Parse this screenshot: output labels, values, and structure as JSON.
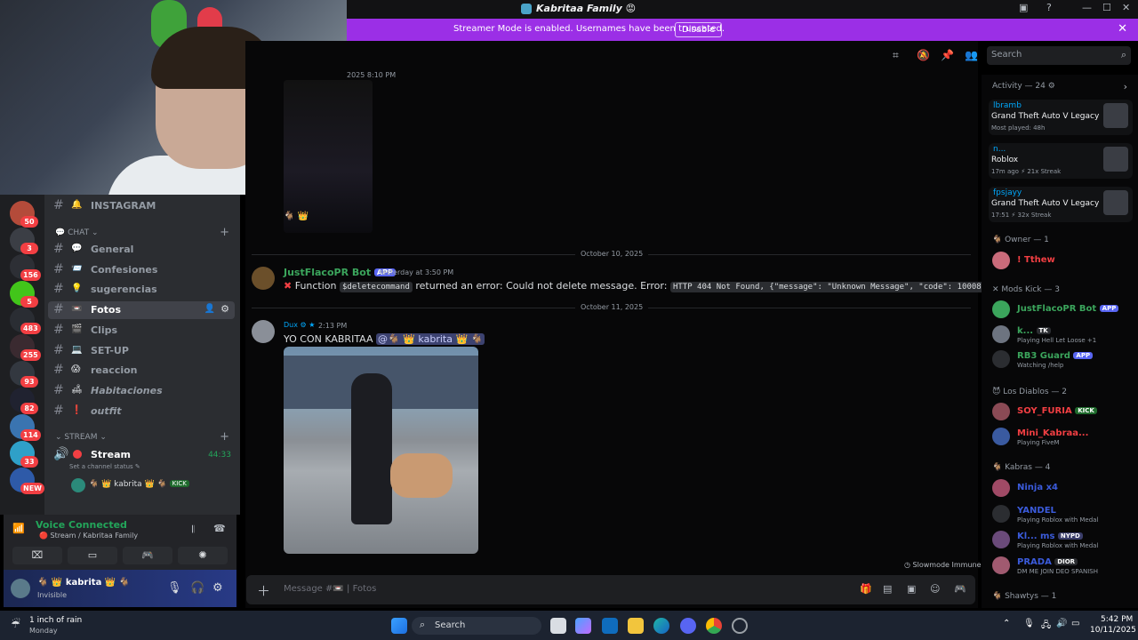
{
  "window": {
    "title": "Kabritaa Family",
    "title_badge": "😡"
  },
  "banner": {
    "message": "Streamer Mode is enabled. Usernames have been truncated.",
    "button": "Disable"
  },
  "search": {
    "placeholder": "Search"
  },
  "servers": [
    {
      "count": "50",
      "color": "#b44b3a"
    },
    {
      "count": "3",
      "color": "#3b3e45"
    },
    {
      "count": "156",
      "color": "#2d2f35"
    },
    {
      "count": "5",
      "color": "#42c51a"
    },
    {
      "count": "483",
      "color": "#2a2d33"
    },
    {
      "count": "255",
      "color": "#3a2a30"
    },
    {
      "count": "93",
      "color": "#333840"
    },
    {
      "count": "82",
      "color": "#202230"
    },
    {
      "count": "114",
      "color": "#3a74b0"
    },
    {
      "count": "33",
      "color": "#2fa0c8"
    },
    {
      "count": "NEW",
      "color": "#2e5aa8"
    }
  ],
  "channels": {
    "top": {
      "emoji": "🔔",
      "name": "INSTAGRAM"
    },
    "chat_category": "CHAT",
    "chat": [
      {
        "emoji": "💬",
        "name": "General"
      },
      {
        "emoji": "📨",
        "name": "Confesiones"
      },
      {
        "emoji": "💡",
        "name": "sugerencias"
      },
      {
        "emoji": "📼",
        "name": "Fotos"
      },
      {
        "emoji": "🎬",
        "name": "Clips"
      },
      {
        "emoji": "💻",
        "name": "SET-UP"
      },
      {
        "emoji": "😱",
        "name": "reaccion"
      },
      {
        "emoji": "🛋",
        "name": "Habitaciones"
      },
      {
        "emoji": "❗",
        "name": "outfit"
      }
    ],
    "stream_category": "STREAM",
    "stream_channel": {
      "name": "Stream",
      "time": "44:33",
      "status": "Set a channel status"
    },
    "stream_user": {
      "name": "kabrita",
      "badge": "KICK"
    }
  },
  "voice": {
    "status": "Voice Connected",
    "channel": "Stream / Kabritaa Family"
  },
  "user": {
    "name": "kabrita",
    "status": "Invisible"
  },
  "messages": {
    "top_timestamp": "2025 8:10 PM",
    "top_emoji": "🐐 👑",
    "date1": "October 10, 2025",
    "bot": {
      "name": "JustFlacoPR Bot",
      "app": "APP",
      "time": "Yesterday at 3:50 PM",
      "text_a": "Function",
      "code_a": "$deletecommand",
      "text_b": "returned an error: Could not delete message. Error:",
      "code_b": "HTTP 404 Not Found, {\"message\": \"Unknown Message\", \"code\": 10008}"
    },
    "date2": "October 11, 2025",
    "dux": {
      "name": "Dux",
      "time": "2:13 PM",
      "text": "YO CON KABRITAA",
      "mention": "@🐐 👑 kabrita 👑 🐐"
    }
  },
  "composer": {
    "placeholder": "Message #📼",
    "channel": "Fotos",
    "slowmode": "Slowmode Immune"
  },
  "members": {
    "activity_header": "Activity — 24",
    "activities": [
      {
        "user": "lbramb",
        "game": "Grand Theft Auto V Legacy",
        "detail": "Most played: 48h"
      },
      {
        "user": "n...",
        "game": "Roblox",
        "detail": "17m ago  ⚡ 21x Streak"
      },
      {
        "user": "fpsjayy",
        "game": "Grand Theft Auto V Legacy",
        "detail": "17:51  ⚡ 32x Streak"
      }
    ],
    "owner_header": "Owner — 1",
    "owner": {
      "name": "! Tthew"
    },
    "mods_header": "Mods Kick — 3",
    "mods": [
      {
        "name": "JustFlacoPR Bot",
        "badge": "APP",
        "sub": ""
      },
      {
        "name": "k...",
        "badge": "TK",
        "sub": "Playing Hell Let Loose +1"
      },
      {
        "name": "RB3 Guard",
        "badge": "APP",
        "sub": "Watching /help"
      }
    ],
    "diablos_header": "Los Diablos — 2",
    "diablos": [
      {
        "name": "SOY_FURIA",
        "badge": "KICK",
        "sub": ""
      },
      {
        "name": "Mini_Kabraa...",
        "badge": "",
        "sub": "Playing FiveM"
      }
    ],
    "kabras_header": "Kabras — 4",
    "kabras": [
      {
        "name": "Ninja x4",
        "badge": "",
        "sub": ""
      },
      {
        "name": "YANDEL",
        "badge": "",
        "sub": "Playing Roblox with Medal"
      },
      {
        "name": "Kl... ms",
        "badge": "NYPD",
        "sub": "Playing Roblox with Medal"
      },
      {
        "name": "PRADA",
        "badge": "DIOR",
        "sub": "DM ME JOIN DEO SPANISH"
      }
    ],
    "shawtys_header": "Shawtys — 1"
  },
  "taskbar": {
    "weather": "1 inch of rain",
    "weather_sub": "Monday",
    "search": "Search",
    "time": "5:42 PM",
    "date": "10/11/2025"
  },
  "colors": {
    "banner": "#9b2fe6",
    "active_channel": "#404249",
    "voice_green": "#23a55a",
    "app_badge": "#5865f2",
    "owner_red": "#f23f43"
  }
}
